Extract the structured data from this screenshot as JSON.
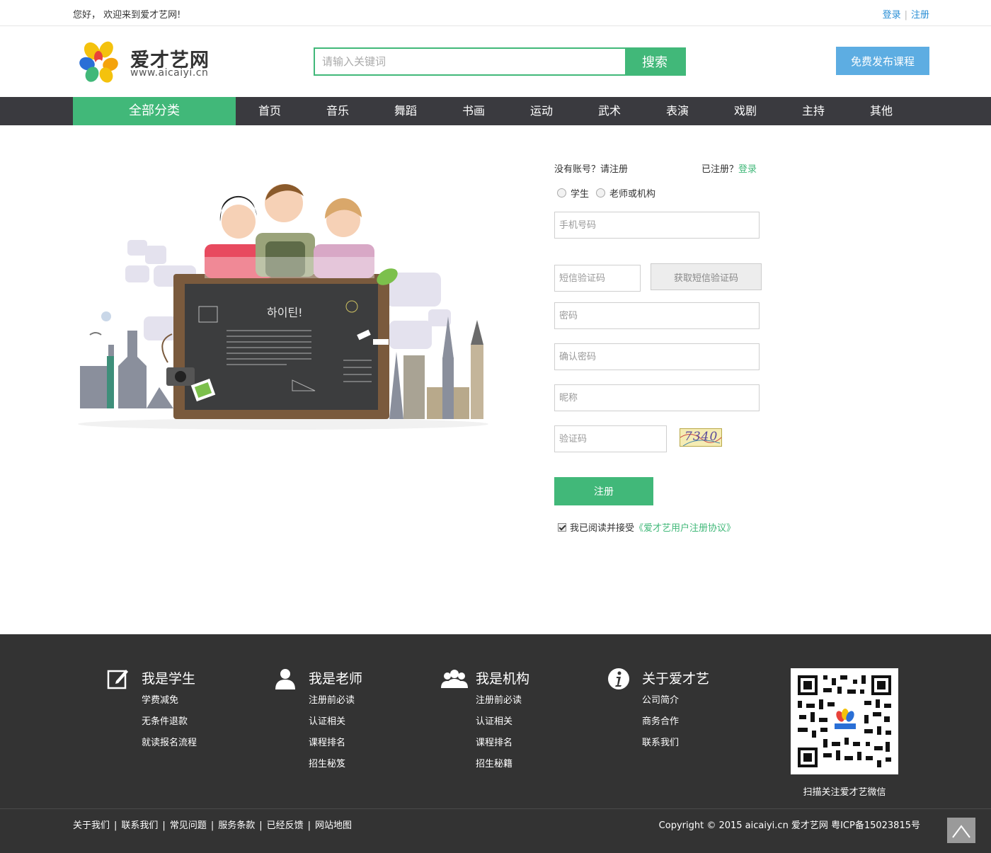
{
  "topbar": {
    "welcome": "您好， 欢迎来到爱才艺网!",
    "login": "登录",
    "separator": "|",
    "register": "注册"
  },
  "header": {
    "logo_name": "爱才艺网",
    "logo_url": "www.aicaiyi.cn",
    "search_placeholder": "请输入关键词",
    "search_button": "搜索",
    "publish_button": "免费发布课程"
  },
  "nav": {
    "all_categories": "全部分类",
    "items": [
      "首页",
      "音乐",
      "舞蹈",
      "书画",
      "运动",
      "武术",
      "表演",
      "戏剧",
      "主持",
      "其他"
    ]
  },
  "illustration": {
    "board_title": "하이틴!"
  },
  "form": {
    "register_prompt": "没有账号？请注册",
    "login_prompt": "已注册？",
    "login_link": "登录",
    "roles": [
      "学生",
      "老师或机构"
    ],
    "phone_placeholder": "手机号码",
    "sms_code_placeholder": "短信验证码",
    "sms_button": "获取短信验证码",
    "password_placeholder": "密码",
    "confirm_password_placeholder": "确认密码",
    "nickname_placeholder": "昵称",
    "captcha_placeholder": "验证码",
    "captcha_text": "7340",
    "submit": "注册",
    "agree_text": "我已阅读并接受",
    "agree_link": "《爱才艺用户注册协议》"
  },
  "footer": {
    "columns": [
      {
        "title": "我是学生",
        "links": [
          "学费减免",
          "无条件退款",
          "就读报名流程"
        ]
      },
      {
        "title": "我是老师",
        "links": [
          "注册前必读",
          "认证相关",
          "课程排名",
          "招生秘笈"
        ]
      },
      {
        "title": "我是机构",
        "links": [
          "注册前必读",
          "认证相关",
          "课程排名",
          "招生秘籍"
        ]
      },
      {
        "title": "关于爱才艺",
        "links": [
          "公司简介",
          "商务合作",
          "联系我们"
        ]
      }
    ],
    "qr_label": "扫描关注爱才艺微信",
    "bottom_links": [
      "关于我们",
      "联系我们",
      "常见问题",
      "服务条款",
      "已经反馈",
      "网站地图"
    ],
    "bottom_separator": "|",
    "copyright": "Copyright © 2015 aicaiyi.cn 爱才艺网 粤ICP备15023815号"
  },
  "colors": {
    "accent_green": "#41b879",
    "nav_dark": "#3a3a3f",
    "publish_blue": "#5dade2",
    "footer_bg": "#333333"
  }
}
